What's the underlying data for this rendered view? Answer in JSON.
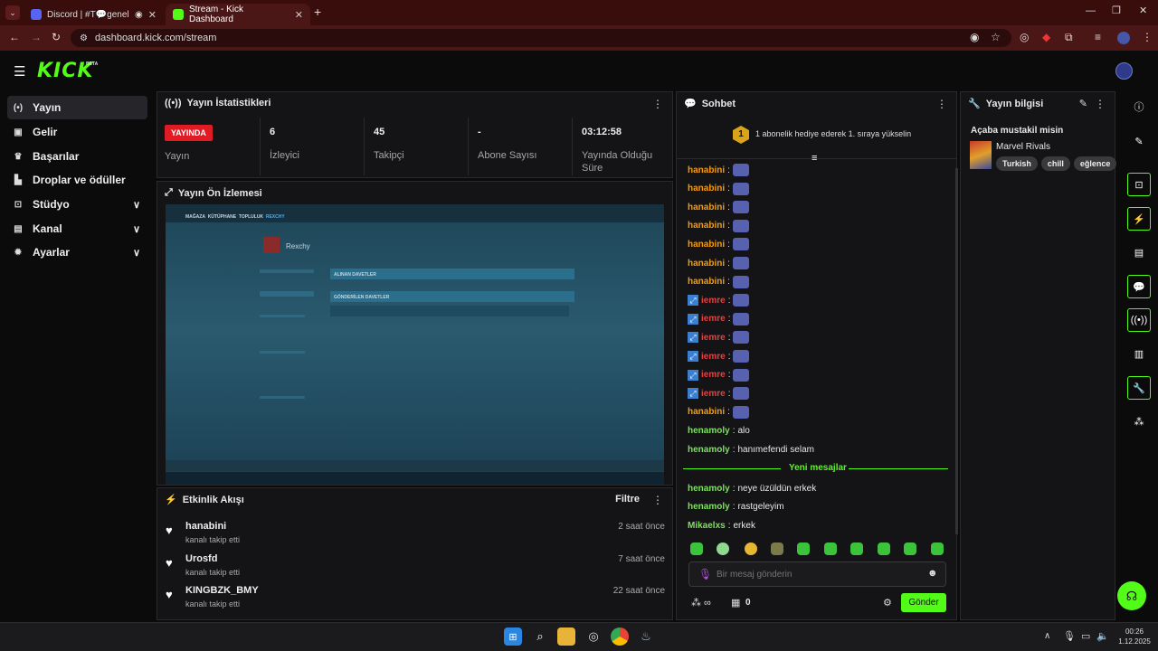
{
  "browser": {
    "tabs": [
      {
        "title": "Discord | #T💬genel | Spo"
      },
      {
        "title": "Stream - Kick Dashboard"
      }
    ],
    "url": "dashboard.kick.com/stream"
  },
  "app": {
    "logo": "KICK",
    "beta": "BETA"
  },
  "sidebar": {
    "items": [
      {
        "label": "Yayın"
      },
      {
        "label": "Gelir"
      },
      {
        "label": "Başarılar"
      },
      {
        "label": "Droplar ve ödüller"
      },
      {
        "label": "Stüdyo"
      },
      {
        "label": "Kanal"
      },
      {
        "label": "Ayarlar"
      }
    ]
  },
  "stats": {
    "title": "Yayın İstatistikleri",
    "live_badge": "YAYINDA",
    "live_label": "Yayın",
    "viewers_value": "6",
    "viewers_label": "İzleyici",
    "followers_value": "45",
    "followers_label": "Takipçi",
    "subs_value": "-",
    "subs_label": "Abone Sayısı",
    "uptime_value": "03:12:58",
    "uptime_label": "Yayında Olduğu Süre"
  },
  "preview": {
    "title": "Yayın Ön İzlemesi",
    "nav": [
      "MAĞAZA",
      "KÜTÜPHANE",
      "TOPLULUK",
      "REXCHY"
    ],
    "username": "Rexchy",
    "received": "ALINAN DAVETLER",
    "sent": "GÖNDERİLEN DAVETLER"
  },
  "activity": {
    "title": "Etkinlik Akışı",
    "filter": "Filtre",
    "items": [
      {
        "name": "hanabini",
        "action": "kanalı takip etti",
        "time": "2 saat önce"
      },
      {
        "name": "Urosfd",
        "action": "kanalı takip etti",
        "time": "7 saat önce"
      },
      {
        "name": "KINGBZK_BMY",
        "action": "kanalı takip etti",
        "time": "22 saat önce"
      }
    ]
  },
  "chat": {
    "title": "Sohbet",
    "pinned_rank": "1",
    "pinned": "1 abonelik hediye ederek 1. sıraya yükselin",
    "messages": [
      {
        "user": "hanabini",
        "sep": ":",
        "text": ""
      },
      {
        "user": "hanabini",
        "sep": ":",
        "text": ""
      },
      {
        "user": "hanabini",
        "sep": ":",
        "text": ""
      },
      {
        "user": "hanabini",
        "sep": ":",
        "text": ""
      },
      {
        "user": "hanabini",
        "sep": ":",
        "text": ""
      },
      {
        "user": "hanabini",
        "sep": ":",
        "text": ""
      },
      {
        "user": "hanabini",
        "sep": ":",
        "text": ""
      },
      {
        "user": "iemre",
        "sep": ":",
        "text": ""
      },
      {
        "user": "iemre",
        "sep": ":",
        "text": ""
      },
      {
        "user": "iemre",
        "sep": ":",
        "text": ""
      },
      {
        "user": "iemre",
        "sep": ":",
        "text": ""
      },
      {
        "user": "iemre",
        "sep": ":",
        "text": ""
      },
      {
        "user": "iemre",
        "sep": ":",
        "text": ""
      },
      {
        "user": "hanabini",
        "sep": ":",
        "text": ""
      },
      {
        "user": "henamoly",
        "sep": ":",
        "text": "alo"
      },
      {
        "user": "henamoly",
        "sep": ":",
        "text": "hanımefendi selam"
      }
    ],
    "new_messages": "Yeni mesajlar",
    "messages_after": [
      {
        "user": "henamoly",
        "sep": ":",
        "text": "neye üzüldün erkek"
      },
      {
        "user": "henamoly",
        "sep": ":",
        "text": "rastgeleyim"
      },
      {
        "user": "Mikaelxs",
        "sep": ":",
        "text": "erkek"
      }
    ],
    "input_placeholder": "Bir mesaj gönderin",
    "points": "0",
    "send": "Gönder"
  },
  "stream_info": {
    "title": "Yayın bilgisi",
    "stream_title": "Açaba mustakil misin",
    "category": "Marvel Rivals",
    "tags": [
      "Turkish",
      "chill",
      "eğlence"
    ]
  },
  "taskbar": {
    "time": "00:26",
    "date": "1.12.2025"
  }
}
